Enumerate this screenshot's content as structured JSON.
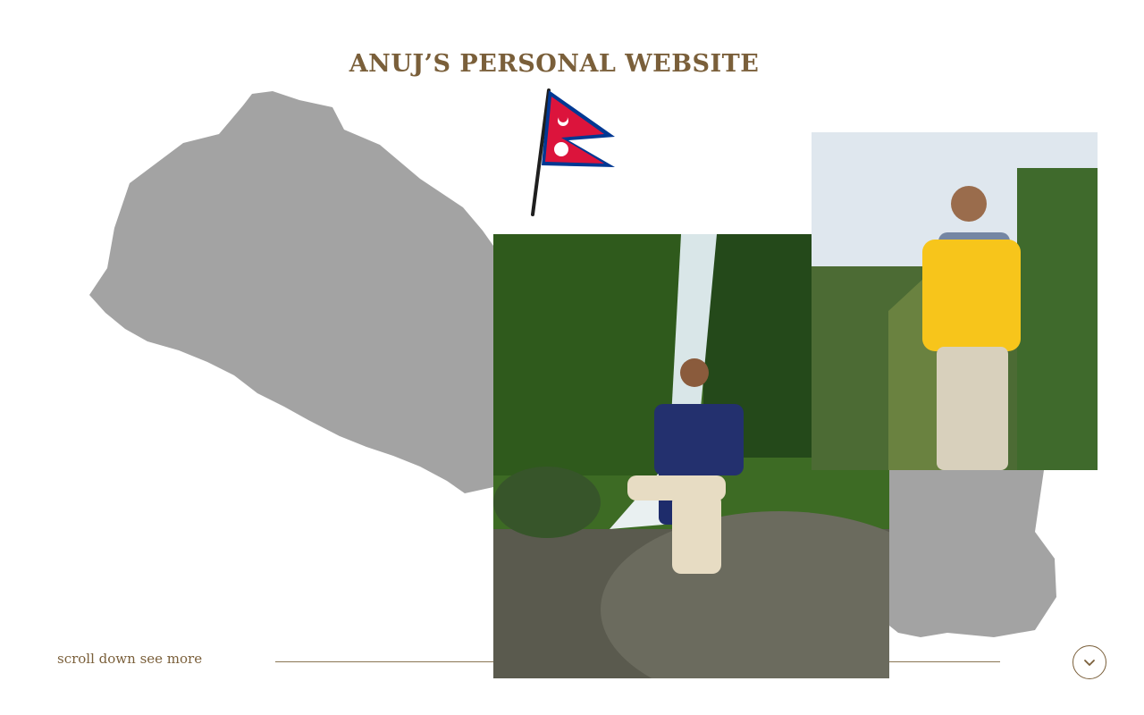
{
  "site": {
    "title": "ANUJ’S PERSONAL WEBSITE"
  },
  "footer": {
    "scroll_text": "scroll down see more",
    "scroll_button_icon": "chevron-down-icon"
  },
  "decorations": {
    "map_icon": "nepal-map-silhouette",
    "flag_icon": "nepal-flag-icon"
  },
  "photos": {
    "main": {
      "subject": "man-sitting-by-waterfall"
    },
    "side": {
      "subject": "man-in-yellow-hoodie"
    }
  },
  "colors": {
    "accent": "#7a5f3a",
    "map": "#a3a3a3",
    "flag_red": "#dc143c",
    "flag_blue": "#003893",
    "background": "#ffffff"
  }
}
